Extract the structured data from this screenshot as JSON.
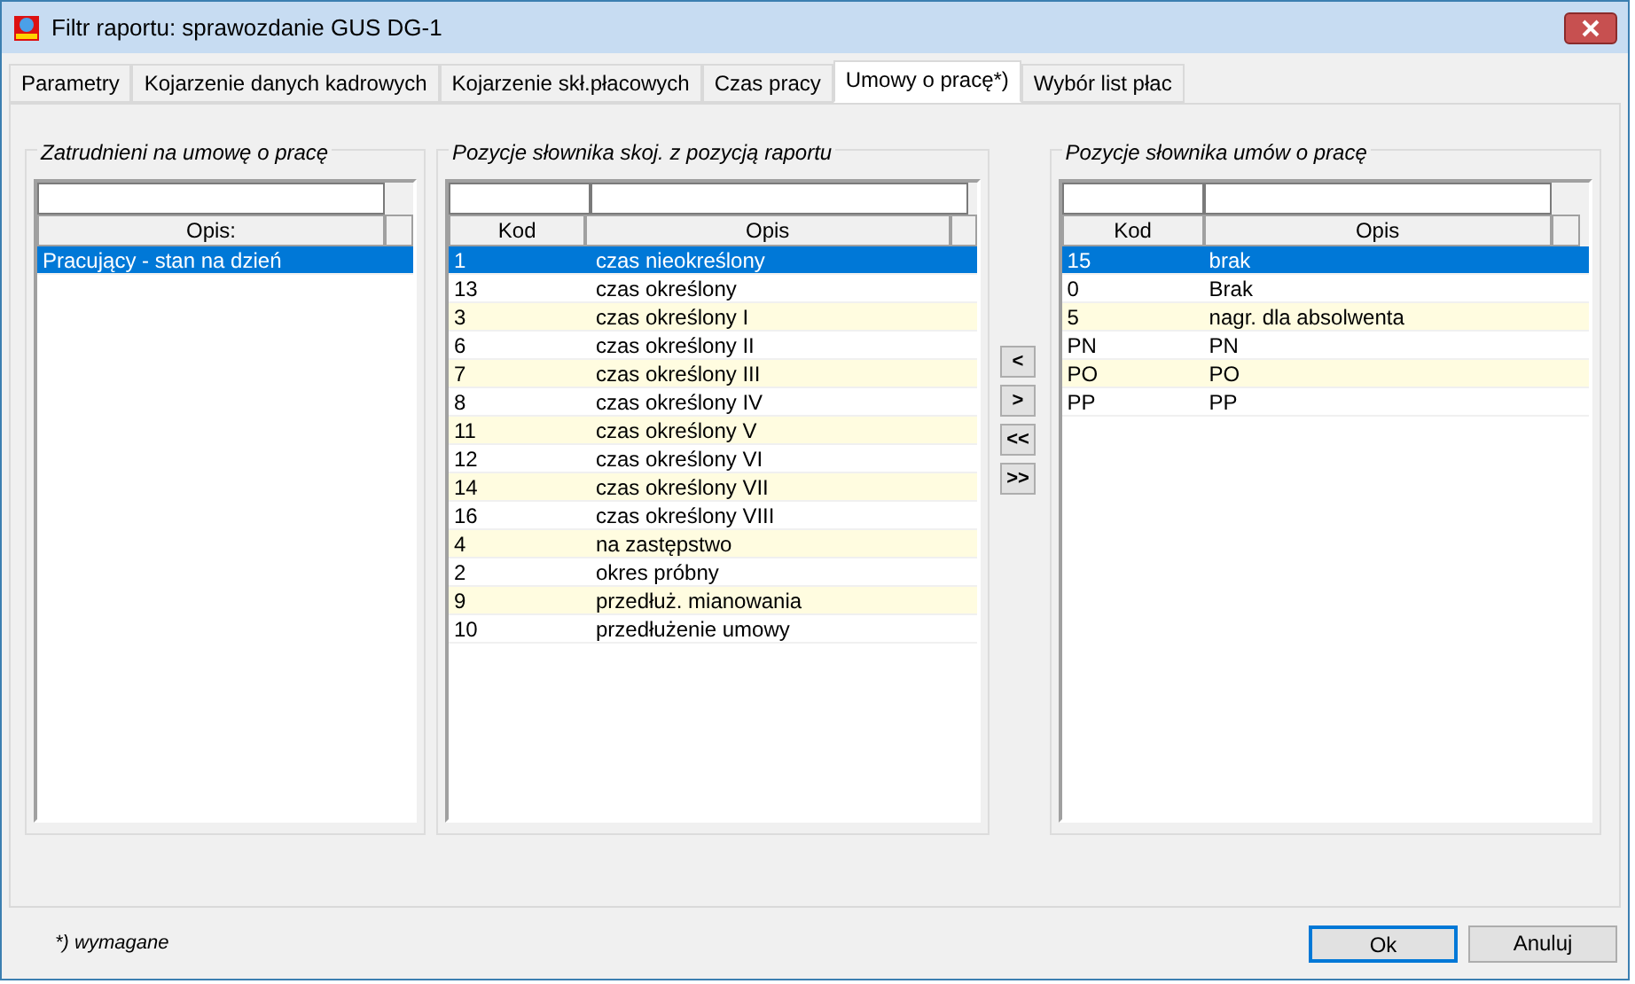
{
  "window": {
    "title": "Filtr raportu: sprawozdanie GUS DG-1"
  },
  "tabs": [
    {
      "label": "Parametry",
      "selected": false
    },
    {
      "label": "Kojarzenie danych kadrowych",
      "selected": false
    },
    {
      "label": "Kojarzenie skł.płacowych",
      "selected": false
    },
    {
      "label": "Czas pracy",
      "selected": false
    },
    {
      "label": "Umowy o pracę*)",
      "selected": true
    },
    {
      "label": "Wybór list płac",
      "selected": false
    }
  ],
  "groups": [
    {
      "title": "Zatrudnieni na umowę o pracę",
      "columns": [
        "Opis:"
      ],
      "rows": [
        {
          "cells": [
            "Pracujący - stan na dzień"
          ],
          "selected": true
        }
      ]
    },
    {
      "title": "Pozycje słownika skoj. z pozycją raportu",
      "columns": [
        "Kod",
        "Opis"
      ],
      "rows": [
        {
          "cells": [
            "1",
            "czas nieokreślony"
          ],
          "selected": true
        },
        {
          "cells": [
            "13",
            "czas określony"
          ],
          "selected": false
        },
        {
          "cells": [
            "3",
            "czas określony I"
          ],
          "selected": false
        },
        {
          "cells": [
            "6",
            "czas określony II"
          ],
          "selected": false
        },
        {
          "cells": [
            "7",
            "czas określony III"
          ],
          "selected": false
        },
        {
          "cells": [
            "8",
            "czas określony IV"
          ],
          "selected": false
        },
        {
          "cells": [
            "11",
            "czas określony V"
          ],
          "selected": false
        },
        {
          "cells": [
            "12",
            "czas określony VI"
          ],
          "selected": false
        },
        {
          "cells": [
            "14",
            "czas określony VII"
          ],
          "selected": false
        },
        {
          "cells": [
            "16",
            "czas określony VIII"
          ],
          "selected": false
        },
        {
          "cells": [
            "4",
            "na zastępstwo"
          ],
          "selected": false
        },
        {
          "cells": [
            "2",
            "okres próbny"
          ],
          "selected": false
        },
        {
          "cells": [
            "9",
            "przedłuż. mianowania"
          ],
          "selected": false
        },
        {
          "cells": [
            "10",
            "przedłużenie umowy"
          ],
          "selected": false
        }
      ]
    },
    {
      "title": "Pozycje słownika umów o pracę",
      "columns": [
        "Kod",
        "Opis"
      ],
      "rows": [
        {
          "cells": [
            "15",
            "brak"
          ],
          "selected": true
        },
        {
          "cells": [
            "0",
            "Brak"
          ],
          "selected": false
        },
        {
          "cells": [
            "5",
            "nagr. dla absolwenta"
          ],
          "selected": false
        },
        {
          "cells": [
            "PN",
            "PN"
          ],
          "selected": false
        },
        {
          "cells": [
            "PO",
            "PO"
          ],
          "selected": false
        },
        {
          "cells": [
            "PP",
            "PP"
          ],
          "selected": false
        }
      ]
    }
  ],
  "move_buttons": [
    "<",
    ">",
    "<<",
    ">>"
  ],
  "footer_note": "*) wymagane",
  "buttons": [
    {
      "label": "Ok",
      "default": true
    },
    {
      "label": "Anuluj",
      "default": false
    }
  ]
}
